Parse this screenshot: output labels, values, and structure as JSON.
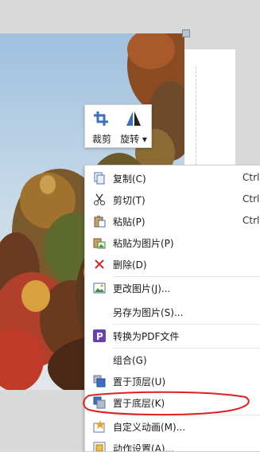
{
  "toolbar": {
    "crop_label": "裁剪",
    "rotate_label": "旋转 ▾"
  },
  "menu": {
    "copy": "复制(C)",
    "copy_shortcut": "Ctrl",
    "cut": "剪切(T)",
    "cut_shortcut": "Ctrl",
    "paste": "粘贴(P)",
    "paste_shortcut": "Ctrl",
    "paste_as_picture": "粘贴为图片(P)",
    "delete": "删除(D)",
    "change_picture": "更改图片(J)...",
    "save_as_picture": "另存为图片(S)...",
    "convert_pdf": "转换为PDF文件",
    "group": "组合(G)",
    "bring_to_front": "置于顶层(U)",
    "send_to_back": "置于底层(K)",
    "custom_animation": "自定义动画(M)...",
    "action_settings": "动作设置(A)..."
  },
  "colors": {
    "annotation": "#e02020",
    "pdf_icon": "#6a3fb0",
    "delete_icon": "#e02020"
  }
}
